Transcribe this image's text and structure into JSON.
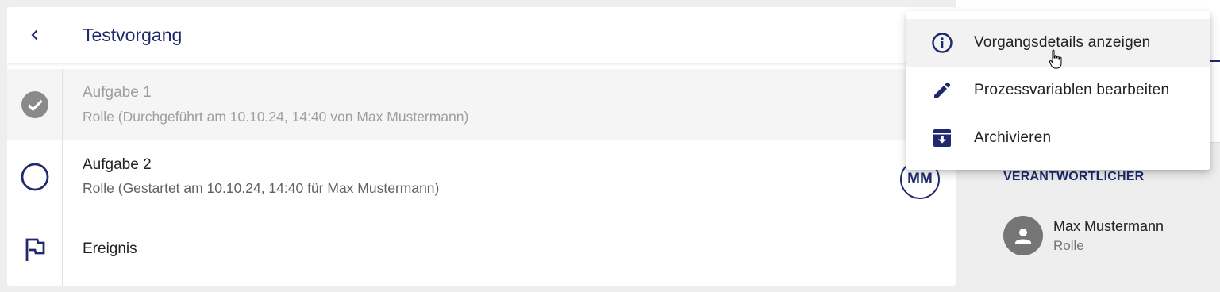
{
  "header": {
    "title": "Testvorgang"
  },
  "tasks": [
    {
      "name": "Aufgabe 1",
      "detail": "Rolle (Durchgeführt am 10.10.24, 14:40 von Max Mustermann)",
      "status": "done"
    },
    {
      "name": "Aufgabe 2",
      "detail": "Rolle (Gestartet am 10.10.24, 14:40 für Max Mustermann)",
      "status": "active",
      "assignee_initials": "MM"
    },
    {
      "name": "Ereignis",
      "status": "event"
    }
  ],
  "side_panel": {
    "section_label": "VERANTWORTLICHER",
    "person_name": "Max Mustermann",
    "person_role": "Rolle"
  },
  "menu": {
    "items": [
      {
        "label": "Vorgangsdetails anzeigen",
        "icon": "info-icon"
      },
      {
        "label": "Prozessvariablen bearbeiten",
        "icon": "pencil-icon"
      },
      {
        "label": "Archivieren",
        "icon": "archive-icon"
      }
    ]
  },
  "colors": {
    "primary": "#1f2a6e",
    "done_gray": "#9e9e9e",
    "background": "#eeeeee"
  }
}
